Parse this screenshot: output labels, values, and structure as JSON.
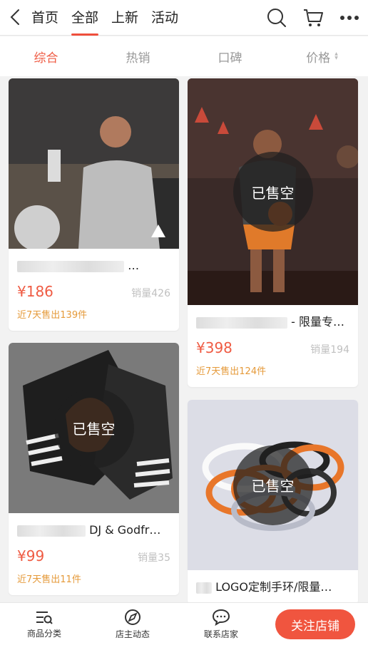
{
  "nav": {
    "tabs": [
      "首页",
      "全部",
      "上新",
      "活动"
    ],
    "active_tab": 1,
    "icons": [
      "back-icon",
      "search-icon",
      "cart-icon",
      "more-icon"
    ]
  },
  "sort": {
    "items": [
      "综合",
      "热销",
      "口碑",
      "价格"
    ],
    "active": 0
  },
  "products": [
    {
      "name": "…",
      "price": "¥186",
      "sales": "销量426",
      "recent": "近7天售出139件",
      "sold_out": false
    },
    {
      "name": "- 限量专…",
      "price": "¥398",
      "sales": "销量194",
      "recent": "近7天售出124件",
      "sold_out": true,
      "badge": "已售空"
    },
    {
      "name": "DJ & Godfr…",
      "price": "¥99",
      "sales": "销量35",
      "recent": "近7天售出11件",
      "sold_out": true,
      "badge": "已售空"
    },
    {
      "name": "LOGO定制手环/限量…",
      "sold_out": true,
      "badge": "已售空"
    }
  ],
  "bottom": {
    "category_label": "商品分类",
    "news_label": "店主动态",
    "contact_label": "联系店家",
    "follow_label": "关注店铺"
  },
  "colors": {
    "accent": "#ef5b43",
    "recent": "#e59a3a"
  }
}
